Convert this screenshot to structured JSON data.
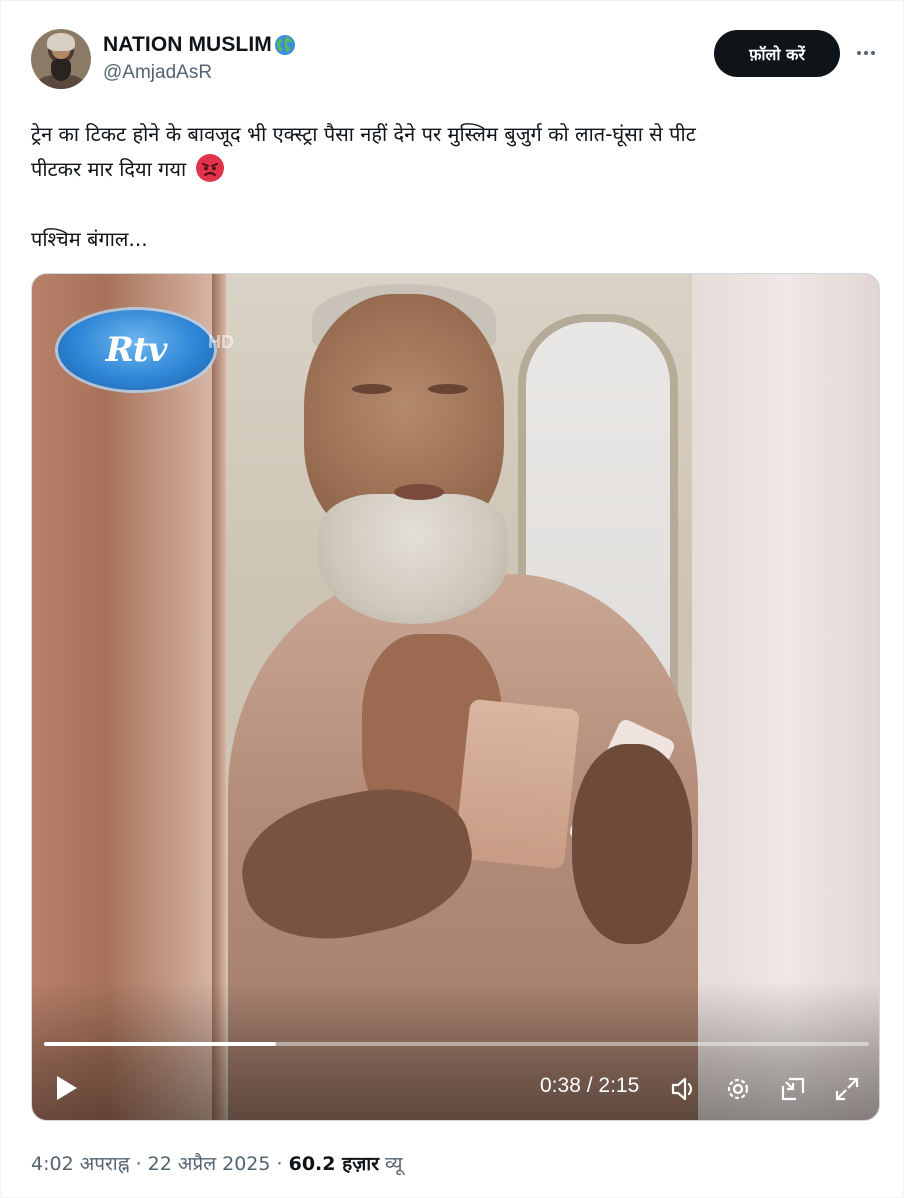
{
  "author": {
    "display_name": "NATION MUSLIM",
    "handle": "@AmjadAsR",
    "badge_icon": "globe-icon"
  },
  "actions": {
    "follow_label": "फ़ॉलो करें",
    "more_icon": "more-horizontal-icon"
  },
  "tweet": {
    "text_line1": "ट्रेन का टिकट होने के बावजूद भी एक्स्ट्रा पैसा नहीं देने पर मुस्लिम बुजुर्ग को लात-घूंसा से पीट",
    "text_line2": "पीटकर मार दिया गया",
    "emoji": "angry-face-icon",
    "text_line3": "पश्चिम बंगाल..."
  },
  "video": {
    "watermark": "Rtv",
    "current_time": "0:38",
    "duration": "2:15",
    "time_separator": " / ",
    "progress_fraction": 0.281,
    "icons": [
      "play-icon",
      "volume-icon",
      "settings-icon",
      "minimize-icon",
      "fullscreen-icon"
    ]
  },
  "meta": {
    "time": "4:02 अपराह्न",
    "date": "22 अप्रैल 2025",
    "separator": " · ",
    "views_count": "60.2 हज़ार",
    "views_label": "व्यू"
  },
  "colors": {
    "text_primary": "#0f1419",
    "text_secondary": "#536471",
    "button_bg": "#0f1419",
    "angry_red": "#e0344a"
  }
}
